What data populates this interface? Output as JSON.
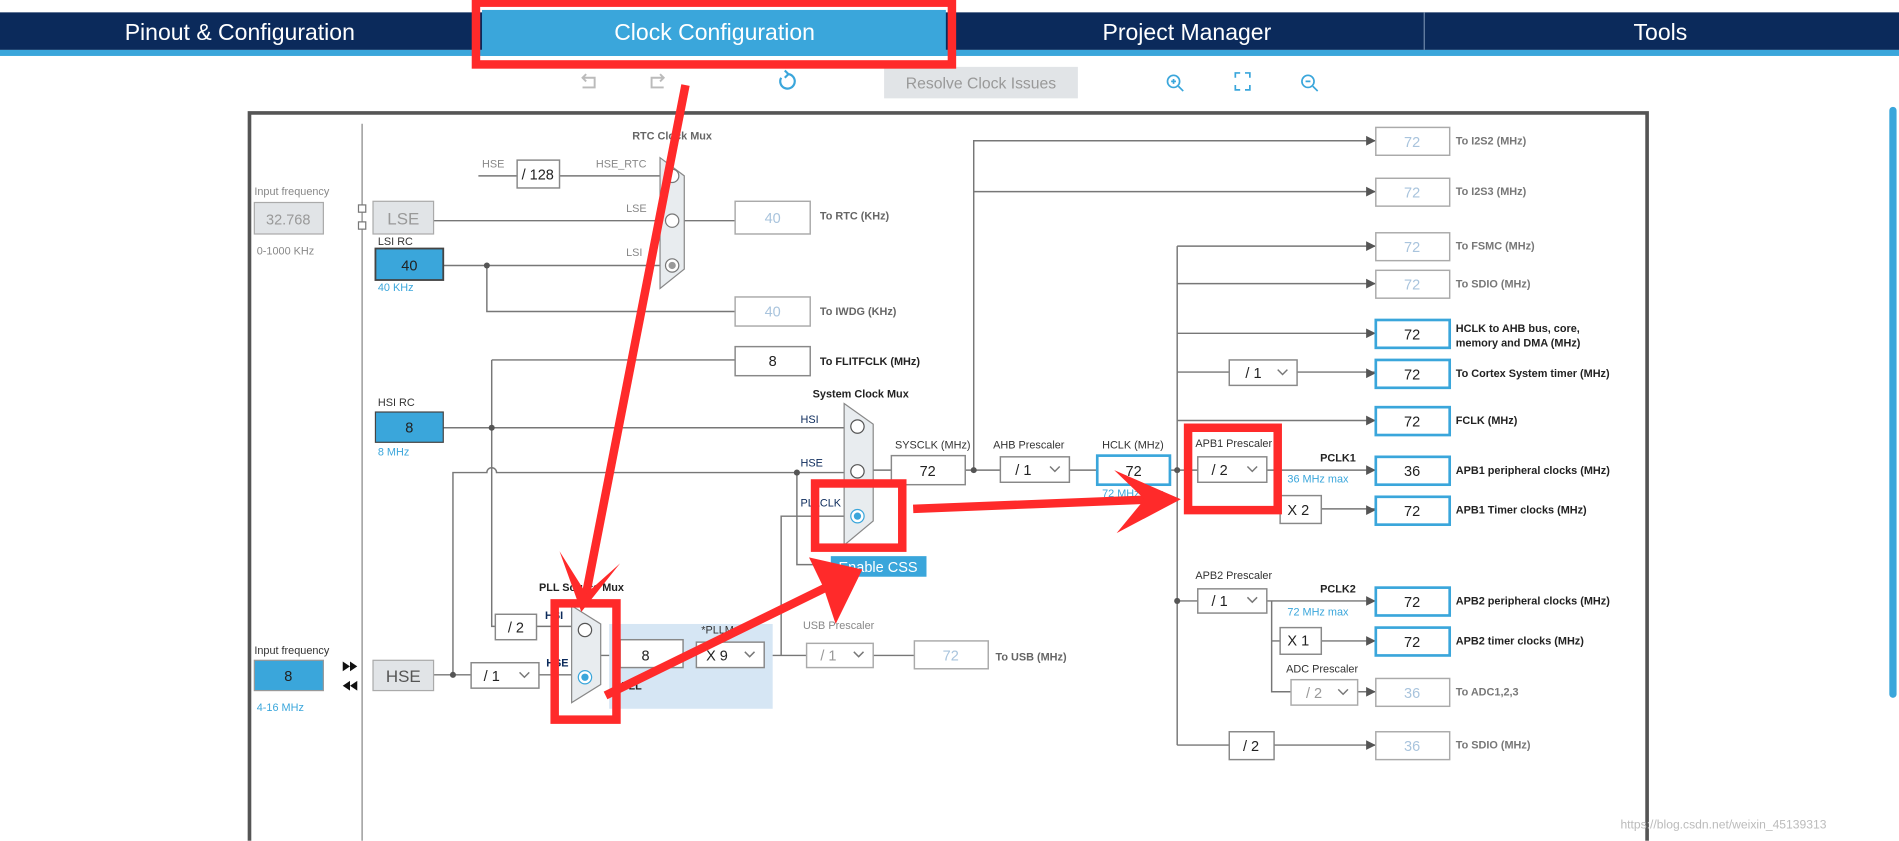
{
  "tabs": [
    {
      "label": "Pinout & Configuration"
    },
    {
      "label": "Clock Configuration",
      "active": true
    },
    {
      "label": "Project Manager"
    },
    {
      "label": "Tools"
    }
  ],
  "toolbar": {
    "resolve_label": "Resolve Clock Issues",
    "icons": [
      "undo-icon",
      "redo-icon",
      "refresh-icon",
      "zoom-in-icon",
      "fit-icon",
      "zoom-out-icon"
    ]
  },
  "lse": {
    "input_label": "Input frequency",
    "input_value": "32.768",
    "range": "0-1000 KHz",
    "name": "LSE"
  },
  "lsi": {
    "label": "LSI RC",
    "value": "40",
    "unit": "40 KHz"
  },
  "hsi": {
    "label": "HSI RC",
    "value": "8",
    "unit": "8 MHz"
  },
  "hse": {
    "input_label": "Input frequency",
    "input_value": "8",
    "range": "4-16 MHz",
    "name": "HSE",
    "div": "/ 1"
  },
  "rtc": {
    "title": "RTC Clock Mux",
    "hse": "HSE",
    "div": "/ 128",
    "hse_rtc": "HSE_RTC",
    "lse": "LSE",
    "lsi": "LSI",
    "rtc_value": "40",
    "rtc_label": "To RTC (KHz)",
    "iwdg_value": "40",
    "iwdg_label": "To IWDG (KHz)"
  },
  "flit": {
    "value": "8",
    "label": "To FLITFCLK (MHz)"
  },
  "sysmux": {
    "title": "System Clock Mux",
    "hsi": "HSI",
    "hse": "HSE",
    "pll": "PLLCLK",
    "css": "Enable CSS"
  },
  "pllmux": {
    "title": "PLL Source Mux",
    "hsi": "HSI",
    "hse": "HSE",
    "div2": "/ 2"
  },
  "pll": {
    "value": "8",
    "mul_label": "*PLLMul",
    "mul": "X 9",
    "label": "PLL"
  },
  "usb": {
    "label": "USB Prescaler",
    "div": "/ 1",
    "value": "72",
    "out": "To USB (MHz)"
  },
  "sysclk": {
    "label": "SYSCLK (MHz)",
    "value": "72"
  },
  "ahb": {
    "label": "AHB Prescaler",
    "div": "/ 1"
  },
  "hclk": {
    "label": "HCLK (MHz)",
    "value": "72",
    "max": "72 MHz max"
  },
  "cortex_div": "/ 1",
  "apb1": {
    "label": "APB1 Prescaler",
    "div": "/ 2",
    "pclk": "PCLK1",
    "max": "36 MHz max",
    "mul": "X 2"
  },
  "apb2": {
    "label": "APB2 Prescaler",
    "div": "/ 1",
    "pclk": "PCLK2",
    "max": "72 MHz max",
    "mul": "X 1"
  },
  "adc": {
    "label": "ADC Prescaler",
    "div": "/ 2"
  },
  "sdio_div": "/ 2",
  "outputs": [
    {
      "value": "72",
      "label": "To I2S2 (MHz)",
      "state": "disabled"
    },
    {
      "value": "72",
      "label": "To I2S3 (MHz)",
      "state": "disabled"
    },
    {
      "value": "72",
      "label": "To FSMC (MHz)",
      "state": "disabled"
    },
    {
      "value": "72",
      "label": "To SDIO (MHz)",
      "state": "disabled"
    },
    {
      "value": "72",
      "label": "HCLK to AHB bus, core,",
      "label2": "memory and DMA (MHz)",
      "state": "active"
    },
    {
      "value": "72",
      "label": "To Cortex System timer (MHz)",
      "state": "active"
    },
    {
      "value": "72",
      "label": "FCLK (MHz)",
      "state": "active"
    },
    {
      "value": "36",
      "label": "APB1 peripheral clocks (MHz)",
      "state": "active"
    },
    {
      "value": "72",
      "label": "APB1 Timer clocks (MHz)",
      "state": "active"
    },
    {
      "value": "72",
      "label": "APB2 peripheral clocks (MHz)",
      "state": "active"
    },
    {
      "value": "72",
      "label": "APB2 timer clocks (MHz)",
      "state": "active"
    },
    {
      "value": "36",
      "label": "To ADC1,2,3",
      "state": "disabled"
    },
    {
      "value": "36",
      "label": "To SDIO (MHz)",
      "state": "disabled"
    }
  ],
  "watermark": "https://blog.csdn.net/weixin_45139313",
  "colors": {
    "header": "#0b2a5b",
    "accent": "#3aa6db",
    "annotation": "#ff2a2a"
  }
}
